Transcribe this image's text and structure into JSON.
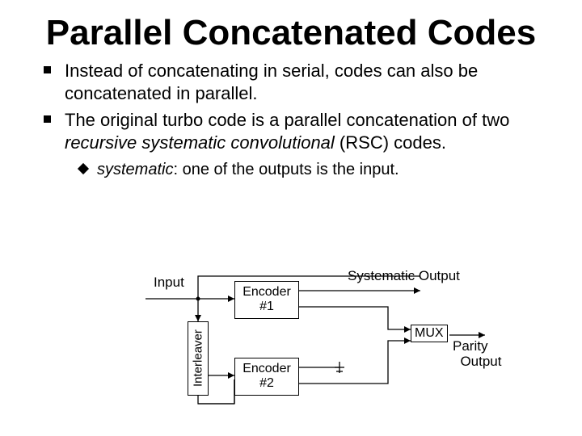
{
  "title": "Parallel Concatenated Codes",
  "bullets": [
    {
      "text_a": "Instead of concatenating in serial, codes can also be concatenated in parallel."
    },
    {
      "text_a": "The original turbo code is a parallel concatenation of two ",
      "text_em": "recursive systematic convolutional",
      "text_b": " (RSC) codes."
    }
  ],
  "sub": {
    "em": "systematic",
    "rest": ": one of the outputs is the input."
  },
  "diagram": {
    "input": "Input",
    "enc1_a": "Encoder",
    "enc1_b": "#1",
    "enc2_a": "Encoder",
    "enc2_b": "#2",
    "interleaver": "Interleaver",
    "sys_out": "Systematic Output",
    "mux": "MUX",
    "parity_a": "Parity",
    "parity_b": "Output"
  }
}
